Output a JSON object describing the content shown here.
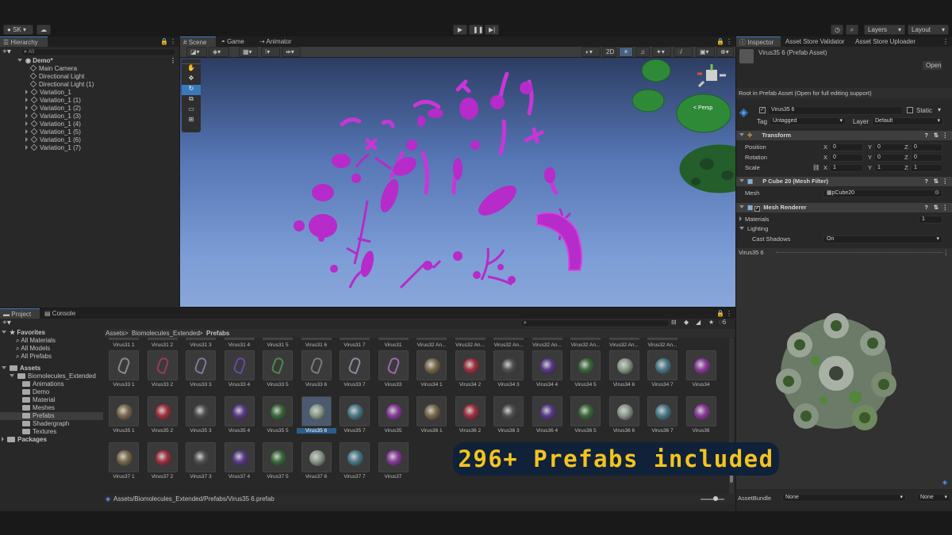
{
  "toolbar": {
    "account": "SK",
    "layers": "Layers",
    "layout": "Layout"
  },
  "hierarchy": {
    "tab": "Hierarchy",
    "search_placeholder": "All",
    "scene": "Demo*",
    "items": [
      "Main Camera",
      "Directional Light",
      "Directional Light (1)",
      "Variation_1",
      "Variation_1 (1)",
      "Variation_1 (2)",
      "Variation_1 (3)",
      "Variation_1 (4)",
      "Variation_1 (5)",
      "Variation_1 (6)",
      "Variation_1 (7)"
    ]
  },
  "scene_tabs": {
    "scene": "Scene",
    "game": "Game",
    "animator": "Animator"
  },
  "scene_toolbar": {
    "mode_2d": "2D",
    "persp": "< Persp"
  },
  "project": {
    "tab": "Project",
    "console": "Console",
    "zoom_count": "6",
    "favorites": "Favorites",
    "favorite_items": [
      "All Materials",
      "All Models",
      "All Prefabs"
    ],
    "assets": "Assets",
    "asset_root": "Biomolecules_Extended",
    "asset_folders": [
      "Animations",
      "Demo",
      "Material",
      "Meshes",
      "Prefabs",
      "Shadergraph",
      "Textures"
    ],
    "packages": "Packages",
    "breadcrumb": [
      "Assets",
      "Biomolecules_Extended",
      "Prefabs"
    ],
    "top_row": [
      "Virus31 1",
      "Virus31 2",
      "Virus31 3",
      "Virus31 4",
      "Virus31 5",
      "Virus31 6",
      "Virus31 7",
      "Virus31",
      "Virus32 An...",
      "Virus32 An...",
      "Virus32 An...",
      "Virus32 An...",
      "Virus32 An...",
      "Virus32 An...",
      "Virus32 An..."
    ],
    "row1": [
      "Virus33 1",
      "Virus33 2",
      "Virus33 3",
      "Virus33 4",
      "Virus33 5",
      "Virus33 6",
      "Virus33 7",
      "Virus33",
      "Virus34 1",
      "Virus34 2",
      "Virus34 3",
      "Virus34 4",
      "Virus34 5",
      "Virus34 6",
      "Virus34 7",
      "Virus34"
    ],
    "row2": [
      "Virus35 1",
      "Virus35 2",
      "Virus35 3",
      "Virus35 4",
      "Virus35 5",
      "Virus35 6",
      "Virus35 7",
      "Virus35",
      "Virus36 1",
      "Virus36 2",
      "Virus36 3",
      "Virus36 4",
      "Virus36 5",
      "Virus36 6",
      "Virus36 7",
      "Virus36"
    ],
    "row3": [
      "Virus37 1",
      "Virus37 2",
      "Virus37 3",
      "Virus37 4",
      "Virus37 5",
      "Virus37 6",
      "Virus37 7",
      "Virus37"
    ],
    "path": "Assets/Biomolecules_Extended/Prefabs/Virus35 6.prefab"
  },
  "inspector": {
    "tabs": [
      "Inspector",
      "Asset Store Validator",
      "Asset Store Uploader"
    ],
    "title": "Virus35 6 (Prefab Asset)",
    "open": "Open",
    "root_note": "Root in Prefab Asset (Open for full editing support)",
    "object_name": "Virus35 6",
    "static": "Static",
    "tag_label": "Tag",
    "tag": "Untagged",
    "layer_label": "Layer",
    "layer": "Default",
    "transform": "Transform",
    "position": "Position",
    "rotation": "Rotation",
    "scale": "Scale",
    "pos": [
      "0",
      "0",
      "0"
    ],
    "rot": [
      "0",
      "0",
      "0"
    ],
    "scl": [
      "1",
      "1",
      "1"
    ],
    "axes": [
      "X",
      "Y",
      "Z"
    ],
    "mesh_filter": "P Cube 20 (Mesh Filter)",
    "mesh_label": "Mesh",
    "mesh": "pCube20",
    "mesh_renderer": "Mesh Renderer",
    "materials": "Materials",
    "materials_count": "1",
    "lighting": "Lighting",
    "cast_shadows": "Cast Shadows",
    "cast_value": "On",
    "preview_title": "Virus35 6",
    "assetbundle": "AssetBundle",
    "ab_value": "None",
    "ab_variant": "None"
  },
  "banner": "296+ Prefabs included",
  "colors": {
    "accent": "#3a79bb",
    "banner_text": "#f3c41e",
    "banner_bg": "#10213a",
    "virus_purple": "#b62bc9",
    "virus_green": "#2f8a38"
  }
}
